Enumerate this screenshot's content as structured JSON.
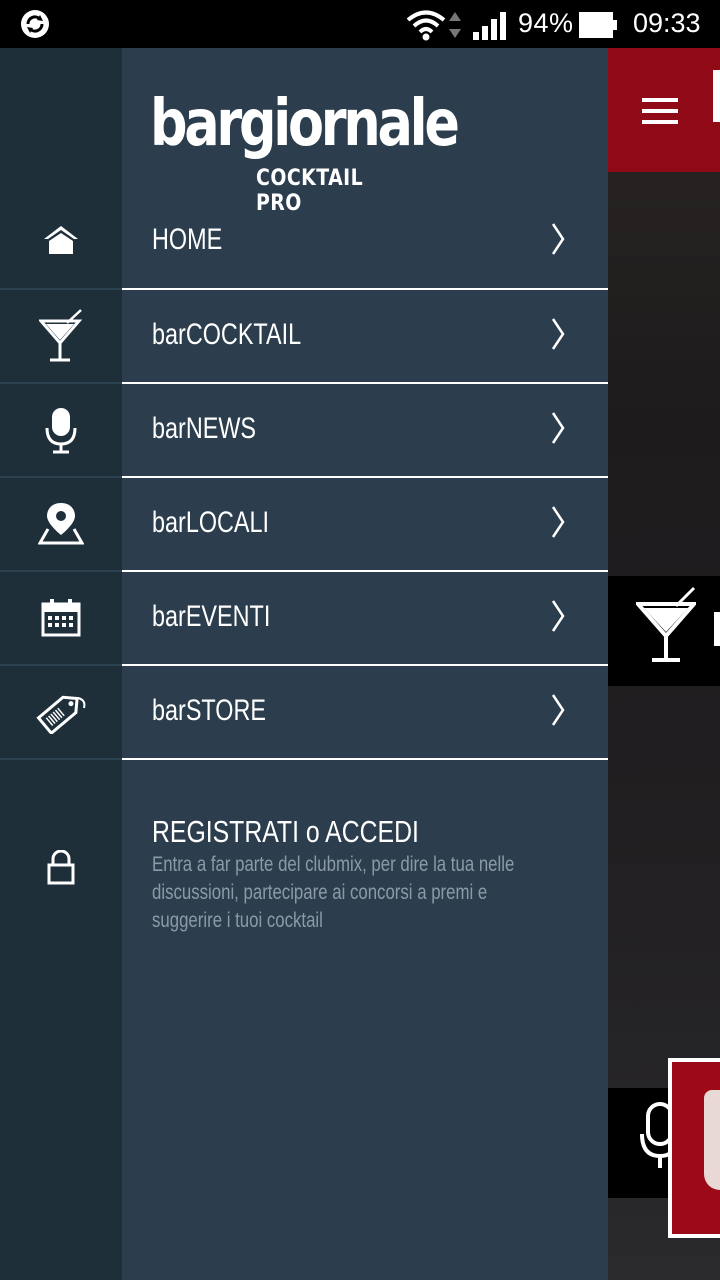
{
  "status_bar": {
    "battery_percent": "94%",
    "time": "09:33",
    "icons": [
      "sync-icon",
      "wifi-icon",
      "data-arrows-icon",
      "signal-icon",
      "battery-icon"
    ]
  },
  "drawer": {
    "logo": {
      "main": "bargiornale",
      "sub": "COCKTAIL PRO"
    },
    "items": [
      {
        "label": "HOME",
        "icon": "home-icon"
      },
      {
        "label": "barCOCKTAIL",
        "icon": "cocktail-icon"
      },
      {
        "label": "barNEWS",
        "icon": "microphone-icon"
      },
      {
        "label": "barLOCALI",
        "icon": "map-pin-icon"
      },
      {
        "label": "barEVENTI",
        "icon": "calendar-icon"
      },
      {
        "label": "barSTORE",
        "icon": "tag-icon"
      }
    ],
    "register": {
      "title": "REGISTRATI o ACCEDI",
      "description": "Entra a far parte del clubmix, per dire la tua nelle discussioni, partecipare ai concorsi a premi e suggerire i tuoi cocktail",
      "icon": "lock-icon"
    }
  },
  "background_app": {
    "header_color": "#8f0a16",
    "icons": [
      "hamburger-menu-icon",
      "cocktail-icon",
      "microphone-icon"
    ]
  },
  "colors": {
    "drawer_bg": "#2c3e4d",
    "icon_column_bg": "#1f2f3a",
    "brand_red": "#8f0a16"
  }
}
